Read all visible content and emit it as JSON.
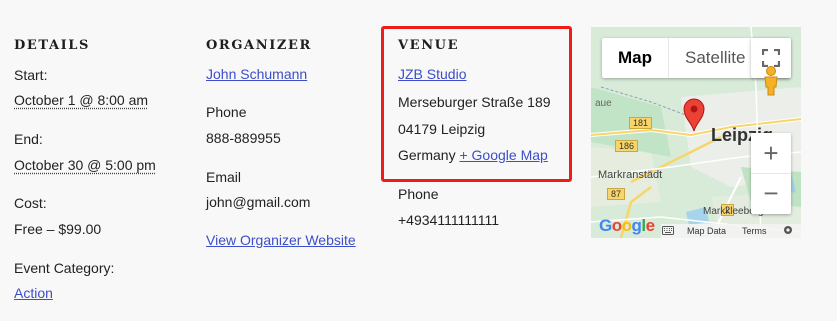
{
  "details": {
    "heading": "DETAILS",
    "start_label": "Start:",
    "start_value": "October 1 @ 8:00 am",
    "end_label": "End:",
    "end_value": "October 30 @ 5:00 pm",
    "cost_label": "Cost:",
    "cost_value": "Free – $99.00",
    "category_label": "Event Category:",
    "category_value": "Action"
  },
  "organizer": {
    "heading": "ORGANIZER",
    "name": "John Schumann",
    "phone_label": "Phone",
    "phone_value": "888-889955",
    "email_label": "Email",
    "email_value": "john@gmail.com",
    "website_link": "View Organizer Website"
  },
  "venue": {
    "heading": "VENUE",
    "name": "JZB Studio",
    "street": "Merseburger Straße 189",
    "city": "04179 Leipzig",
    "country": "Germany",
    "map_link": "+ Google Map",
    "phone_label": "Phone",
    "phone_value": "+4934111111111",
    "highlight_color": "#ef1c1c"
  },
  "map": {
    "type_map": "Map",
    "type_satellite": "Satellite",
    "city_label": "Leipzig",
    "place_markranstadt": "Markranstädt",
    "place_markkleeberg": "Markkleeberg",
    "place_aue": "aue",
    "road_181": "181",
    "road_186": "186",
    "road_87": "87",
    "road_2": "2",
    "logo": "Google",
    "map_data": "Map Data",
    "terms": "Terms",
    "zoom_in": "+",
    "zoom_out": "−"
  }
}
